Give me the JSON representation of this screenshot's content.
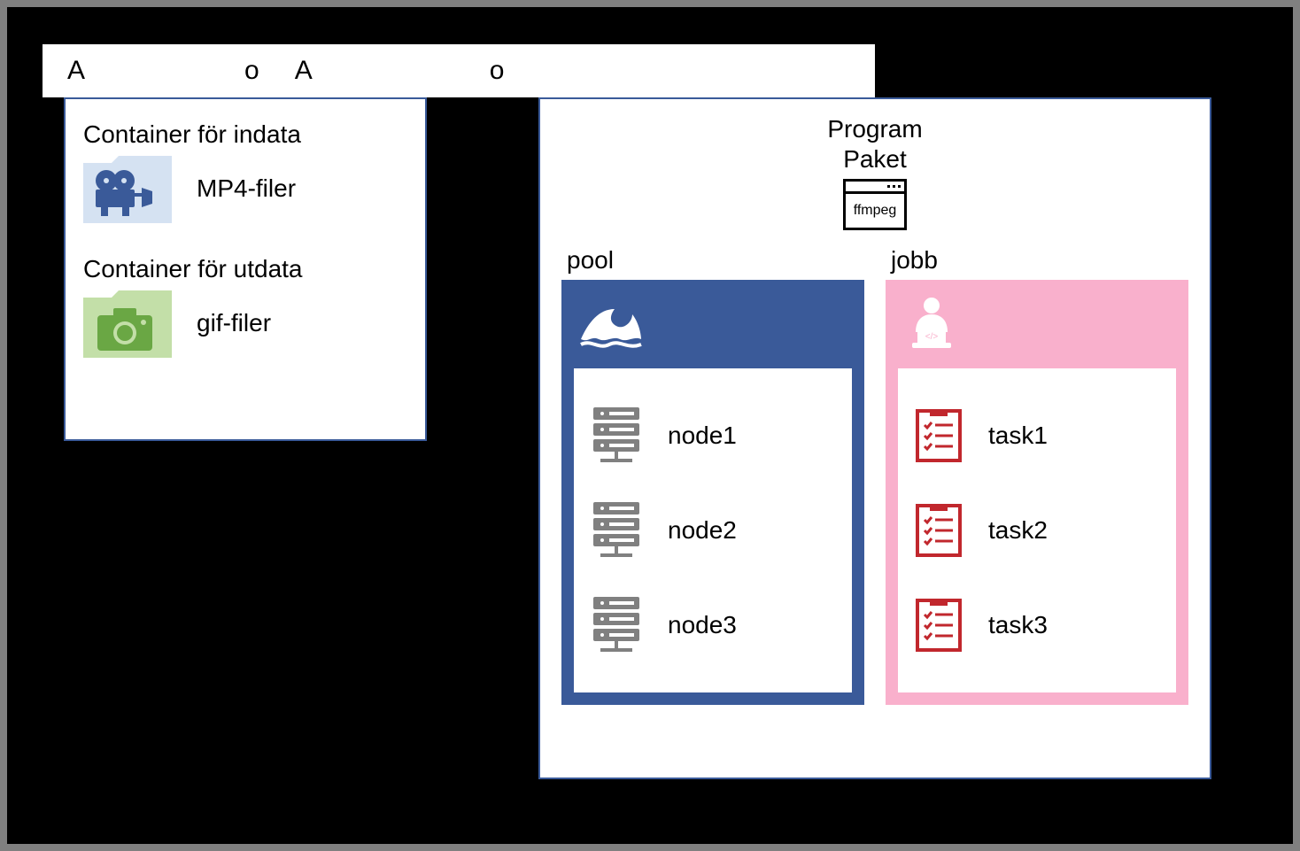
{
  "header": {
    "left": "A",
    "rightLetter": "o",
    "mid": "A",
    "midRight": "o"
  },
  "storage": {
    "indata": {
      "label": "Container för indata",
      "files": "MP4-filer"
    },
    "utdata": {
      "label": "Container för utdata",
      "files": "gif-filer"
    }
  },
  "batch": {
    "program": {
      "title1": "Program",
      "title2": "Paket",
      "package": "ffmpeg"
    },
    "pool": {
      "title": "pool",
      "items": [
        "node1",
        "node2",
        "node3"
      ]
    },
    "jobb": {
      "title": "jobb",
      "items": [
        "task1",
        "task2",
        "task3"
      ]
    }
  },
  "colors": {
    "blue": "#3a5a99",
    "pink": "#f9b0cc",
    "folderBlue": "#d5e2f2",
    "folderGreen": "#c3dfa8",
    "iconBlue": "#3a5a99",
    "iconGreen": "#6aa744",
    "server": "#808080",
    "taskRed": "#c1272d"
  }
}
